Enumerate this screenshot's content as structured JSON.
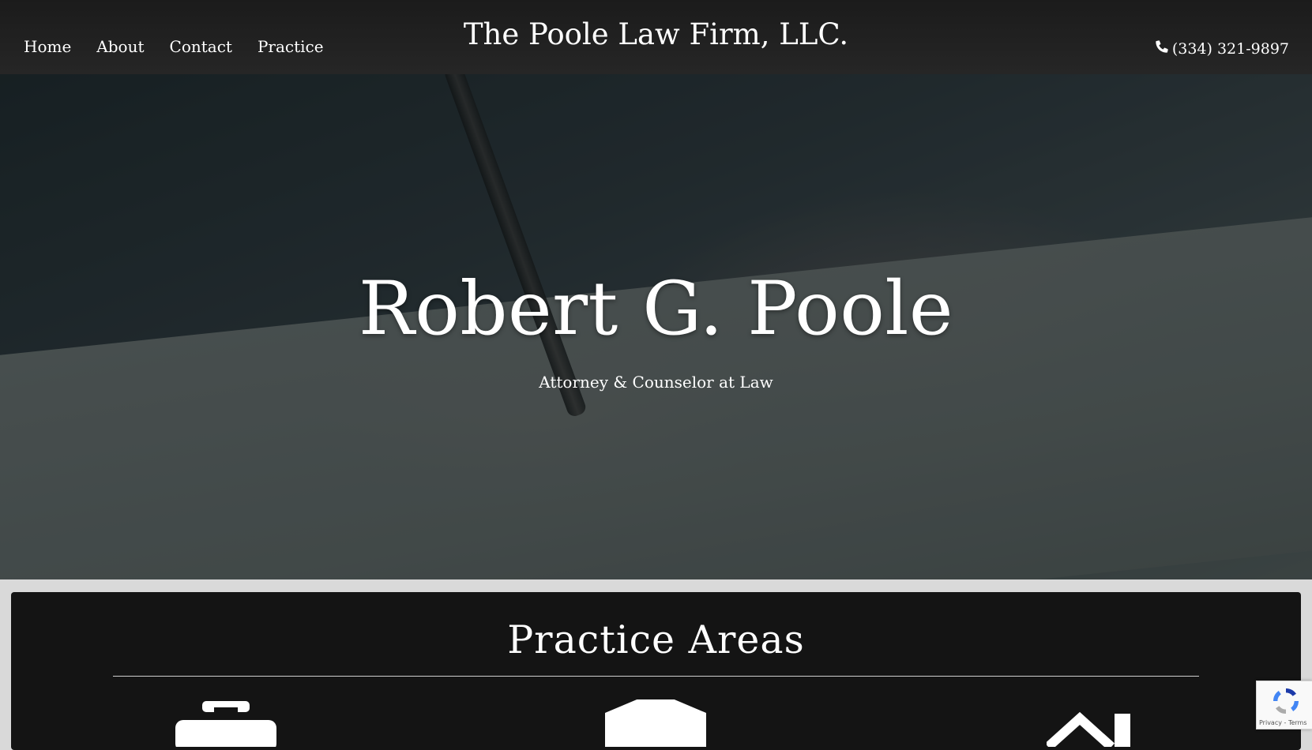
{
  "nav": {
    "links": [
      "Home",
      "About",
      "Contact",
      "Practice"
    ],
    "brand": "The Poole Law Firm, LLC.",
    "phone": "(334) 321-9897"
  },
  "hero": {
    "title": "Robert G. Poole",
    "subtitle": "Attorney & Counselor at Law"
  },
  "practice": {
    "title": "Practice Areas",
    "icons": [
      "briefcase-icon",
      "graduation-cap-icon",
      "house-icon"
    ]
  },
  "recaptcha": {
    "terms": "Privacy - Terms"
  },
  "colors": {
    "navbar": "#222222",
    "panel": "#141414",
    "page_background": "#d9d9d9",
    "text": "#ffffff"
  }
}
